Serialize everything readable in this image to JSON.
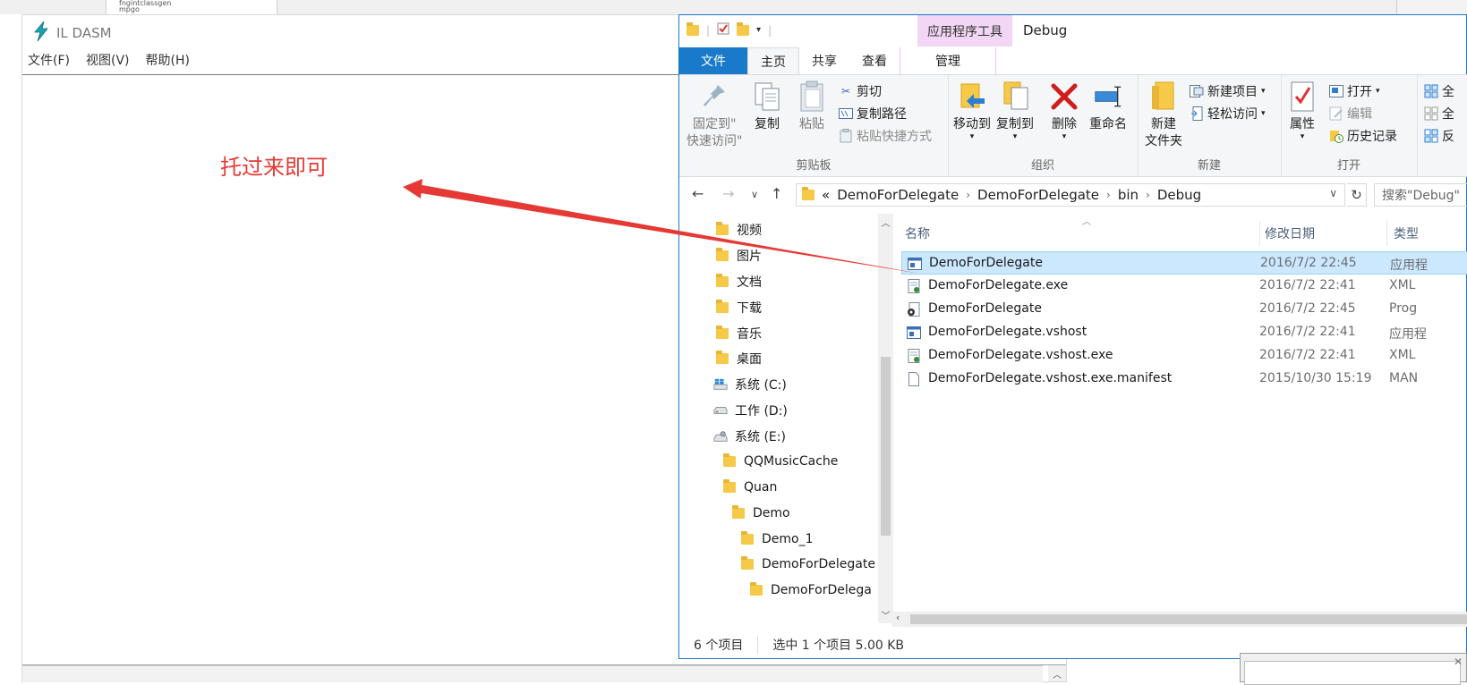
{
  "background": {
    "window_items": [
      "fngintclassgen",
      "mpgo"
    ]
  },
  "ildasm": {
    "title": "IL DASM",
    "menu": [
      "文件(F)",
      "视图(V)",
      "帮助(H)"
    ]
  },
  "annotation": {
    "text": "托过来即可",
    "color": "#e53935"
  },
  "explorer": {
    "contextual_tab_group": "应用程序工具",
    "window_title": "Debug",
    "tabs": {
      "file": "文件",
      "home": "主页",
      "share": "共享",
      "view": "查看",
      "manage": "管理"
    },
    "ribbon": {
      "clipboard": {
        "label": "剪贴板",
        "pin_line1": "固定到\"",
        "pin_line2": "快速访问\"",
        "copy": "复制",
        "paste": "粘贴",
        "cut": "剪切",
        "copy_path": "复制路径",
        "paste_shortcut": "粘贴快捷方式"
      },
      "organize": {
        "label": "组织",
        "move_to": "移动到",
        "copy_to": "复制到",
        "delete": "删除",
        "rename": "重命名"
      },
      "new": {
        "label": "新建",
        "new_folder_line1": "新建",
        "new_folder_line2": "文件夹",
        "new_item": "新建项目",
        "easy_access": "轻松访问"
      },
      "open": {
        "label": "打开",
        "properties": "属性",
        "open": "打开",
        "edit": "编辑",
        "history": "历史记录"
      },
      "select": {
        "item1": "全",
        "item2": "全",
        "item3": "反"
      }
    },
    "address": {
      "overflow": "«",
      "crumbs": [
        "DemoForDelegate",
        "DemoForDelegate",
        "bin",
        "Debug"
      ]
    },
    "search": {
      "placeholder": "搜索\"Debug\""
    },
    "nav_pane": [
      {
        "label": "视频",
        "icon": "videos-folder-icon"
      },
      {
        "label": "图片",
        "icon": "pictures-folder-icon"
      },
      {
        "label": "文档",
        "icon": "documents-folder-icon"
      },
      {
        "label": "下载",
        "icon": "downloads-folder-icon"
      },
      {
        "label": "音乐",
        "icon": "music-folder-icon"
      },
      {
        "label": "桌面",
        "icon": "desktop-folder-icon"
      },
      {
        "label": "系统 (C:)",
        "icon": "windows-drive-icon"
      },
      {
        "label": "工作 (D:)",
        "icon": "drive-icon"
      },
      {
        "label": "系统 (E:)",
        "icon": "drive-icon"
      },
      {
        "label": "QQMusicCache",
        "icon": "folder-icon"
      },
      {
        "label": "Quan",
        "icon": "folder-icon"
      },
      {
        "label": "Demo",
        "icon": "folder-icon"
      },
      {
        "label": "Demo_1",
        "icon": "folder-icon"
      },
      {
        "label": "DemoForDelegate",
        "icon": "folder-icon"
      },
      {
        "label": "DemoForDelega",
        "icon": "folder-icon"
      }
    ],
    "columns": {
      "name": "名称",
      "date": "修改日期",
      "type": "类型"
    },
    "files": [
      {
        "name": "DemoForDelegate",
        "date": "2016/7/2 22:45",
        "type": "应用程",
        "icon": "application-icon",
        "selected": true
      },
      {
        "name": "DemoForDelegate.exe",
        "date": "2016/7/2 22:41",
        "type": "XML",
        "icon": "config-file-icon",
        "selected": false
      },
      {
        "name": "DemoForDelegate",
        "date": "2016/7/2 22:45",
        "type": "Prog",
        "icon": "pdb-file-icon",
        "selected": false
      },
      {
        "name": "DemoForDelegate.vshost",
        "date": "2016/7/2 22:41",
        "type": "应用程",
        "icon": "application-icon",
        "selected": false
      },
      {
        "name": "DemoForDelegate.vshost.exe",
        "date": "2016/7/2 22:41",
        "type": "XML",
        "icon": "config-file-icon",
        "selected": false
      },
      {
        "name": "DemoForDelegate.vshost.exe.manifest",
        "date": "2015/10/30 15:19",
        "type": "MAN",
        "icon": "blank-file-icon",
        "selected": false
      }
    ],
    "status": {
      "item_count": "6 个项目",
      "selection": "选中 1 个项目  5.00 KB"
    }
  }
}
